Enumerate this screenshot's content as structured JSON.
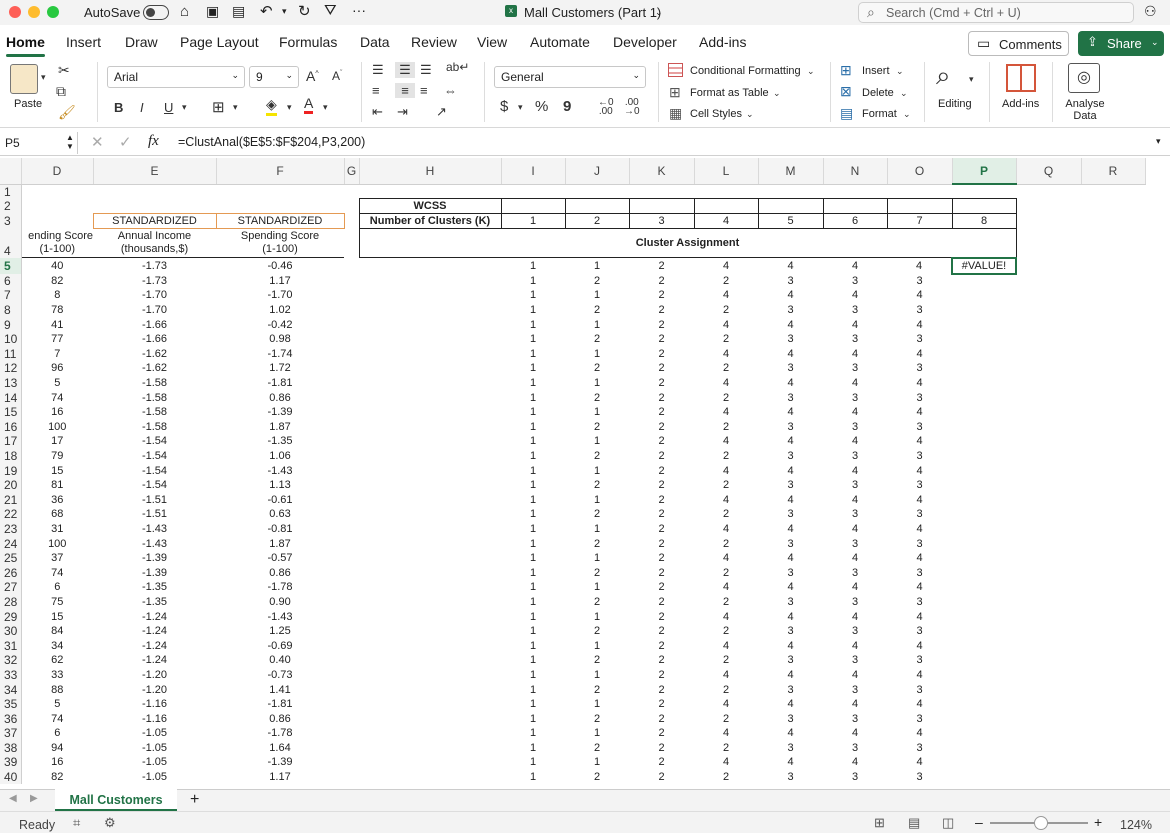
{
  "window": {
    "autosave": "AutoSave",
    "title": "Mall Customers (Part 1)",
    "search_placeholder": "Search (Cmd + Ctrl + U)"
  },
  "ribbon_tabs": [
    "Home",
    "Insert",
    "Draw",
    "Page Layout",
    "Formulas",
    "Data",
    "Review",
    "View",
    "Automate",
    "Developer",
    "Add-ins"
  ],
  "buttons": {
    "comments": "Comments",
    "share": "Share"
  },
  "ribbon": {
    "paste": "Paste",
    "font": "Arial",
    "size": "9",
    "number_format": "General",
    "cond_format": "Conditional Formatting",
    "format_table": "Format as Table",
    "cell_styles": "Cell Styles",
    "insert": "Insert",
    "delete": "Delete",
    "format": "Format",
    "editing": "Editing",
    "addins": "Add-ins",
    "analyse": "Analyse Data",
    "bold": "B",
    "italic": "I",
    "underline": "U",
    "currency": "$",
    "percent": "%",
    "comma": "9"
  },
  "formula_bar": {
    "name_box": "P5",
    "fx": "fx",
    "formula": "=ClustAnal($E$5:$F$204,P3,200)"
  },
  "columns": [
    "D",
    "E",
    "F",
    "G",
    "H",
    "I",
    "J",
    "K",
    "L",
    "M",
    "N",
    "O",
    "P",
    "Q",
    "R"
  ],
  "header": {
    "e3": "STANDARDIZED",
    "f3": "STANDARDIZED",
    "d4": "ending Score",
    "d4b": "(1-100)",
    "e4": "Annual Income",
    "e4b": "(thousands,$)",
    "f4": "Spending Score",
    "f4b": "(1-100)",
    "wcss": "WCSS",
    "nclusters": "Number of Clusters (K)",
    "k": [
      "1",
      "2",
      "3",
      "4",
      "5",
      "6",
      "7",
      "8"
    ],
    "assign": "Cluster Assignment",
    "error": "#VALUE!"
  },
  "rows": [
    [
      "40",
      "-1.73",
      "-0.46",
      "1",
      "1",
      "2",
      "4",
      "4",
      "4",
      "4"
    ],
    [
      "82",
      "-1.73",
      "1.17",
      "1",
      "2",
      "2",
      "2",
      "3",
      "3",
      "3"
    ],
    [
      "8",
      "-1.70",
      "-1.70",
      "1",
      "1",
      "2",
      "4",
      "4",
      "4",
      "4"
    ],
    [
      "78",
      "-1.70",
      "1.02",
      "1",
      "2",
      "2",
      "2",
      "3",
      "3",
      "3"
    ],
    [
      "41",
      "-1.66",
      "-0.42",
      "1",
      "1",
      "2",
      "4",
      "4",
      "4",
      "4"
    ],
    [
      "77",
      "-1.66",
      "0.98",
      "1",
      "2",
      "2",
      "2",
      "3",
      "3",
      "3"
    ],
    [
      "7",
      "-1.62",
      "-1.74",
      "1",
      "1",
      "2",
      "4",
      "4",
      "4",
      "4"
    ],
    [
      "96",
      "-1.62",
      "1.72",
      "1",
      "2",
      "2",
      "2",
      "3",
      "3",
      "3"
    ],
    [
      "5",
      "-1.58",
      "-1.81",
      "1",
      "1",
      "2",
      "4",
      "4",
      "4",
      "4"
    ],
    [
      "74",
      "-1.58",
      "0.86",
      "1",
      "2",
      "2",
      "2",
      "3",
      "3",
      "3"
    ],
    [
      "16",
      "-1.58",
      "-1.39",
      "1",
      "1",
      "2",
      "4",
      "4",
      "4",
      "4"
    ],
    [
      "100",
      "-1.58",
      "1.87",
      "1",
      "2",
      "2",
      "2",
      "3",
      "3",
      "3"
    ],
    [
      "17",
      "-1.54",
      "-1.35",
      "1",
      "1",
      "2",
      "4",
      "4",
      "4",
      "4"
    ],
    [
      "79",
      "-1.54",
      "1.06",
      "1",
      "2",
      "2",
      "2",
      "3",
      "3",
      "3"
    ],
    [
      "15",
      "-1.54",
      "-1.43",
      "1",
      "1",
      "2",
      "4",
      "4",
      "4",
      "4"
    ],
    [
      "81",
      "-1.54",
      "1.13",
      "1",
      "2",
      "2",
      "2",
      "3",
      "3",
      "3"
    ],
    [
      "36",
      "-1.51",
      "-0.61",
      "1",
      "1",
      "2",
      "4",
      "4",
      "4",
      "4"
    ],
    [
      "68",
      "-1.51",
      "0.63",
      "1",
      "2",
      "2",
      "2",
      "3",
      "3",
      "3"
    ],
    [
      "31",
      "-1.43",
      "-0.81",
      "1",
      "1",
      "2",
      "4",
      "4",
      "4",
      "4"
    ],
    [
      "100",
      "-1.43",
      "1.87",
      "1",
      "2",
      "2",
      "2",
      "3",
      "3",
      "3"
    ],
    [
      "37",
      "-1.39",
      "-0.57",
      "1",
      "1",
      "2",
      "4",
      "4",
      "4",
      "4"
    ],
    [
      "74",
      "-1.39",
      "0.86",
      "1",
      "2",
      "2",
      "2",
      "3",
      "3",
      "3"
    ],
    [
      "6",
      "-1.35",
      "-1.78",
      "1",
      "1",
      "2",
      "4",
      "4",
      "4",
      "4"
    ],
    [
      "75",
      "-1.35",
      "0.90",
      "1",
      "2",
      "2",
      "2",
      "3",
      "3",
      "3"
    ],
    [
      "15",
      "-1.24",
      "-1.43",
      "1",
      "1",
      "2",
      "4",
      "4",
      "4",
      "4"
    ],
    [
      "84",
      "-1.24",
      "1.25",
      "1",
      "2",
      "2",
      "2",
      "3",
      "3",
      "3"
    ],
    [
      "34",
      "-1.24",
      "-0.69",
      "1",
      "1",
      "2",
      "4",
      "4",
      "4",
      "4"
    ],
    [
      "62",
      "-1.24",
      "0.40",
      "1",
      "2",
      "2",
      "2",
      "3",
      "3",
      "3"
    ],
    [
      "33",
      "-1.20",
      "-0.73",
      "1",
      "1",
      "2",
      "4",
      "4",
      "4",
      "4"
    ],
    [
      "88",
      "-1.20",
      "1.41",
      "1",
      "2",
      "2",
      "2",
      "3",
      "3",
      "3"
    ],
    [
      "5",
      "-1.16",
      "-1.81",
      "1",
      "1",
      "2",
      "4",
      "4",
      "4",
      "4"
    ],
    [
      "74",
      "-1.16",
      "0.86",
      "1",
      "2",
      "2",
      "2",
      "3",
      "3",
      "3"
    ],
    [
      "6",
      "-1.05",
      "-1.78",
      "1",
      "1",
      "2",
      "4",
      "4",
      "4",
      "4"
    ],
    [
      "94",
      "-1.05",
      "1.64",
      "1",
      "2",
      "2",
      "2",
      "3",
      "3",
      "3"
    ],
    [
      "16",
      "-1.05",
      "-1.39",
      "1",
      "1",
      "2",
      "4",
      "4",
      "4",
      "4"
    ],
    [
      "82",
      "-1.05",
      "1.17",
      "1",
      "2",
      "2",
      "2",
      "3",
      "3",
      "3"
    ]
  ],
  "sheet_tab": "Mall Customers",
  "status": {
    "ready": "Ready",
    "zoom": "124%"
  },
  "colors": {
    "accent": "#217346",
    "orange_border": "#e49a53"
  }
}
